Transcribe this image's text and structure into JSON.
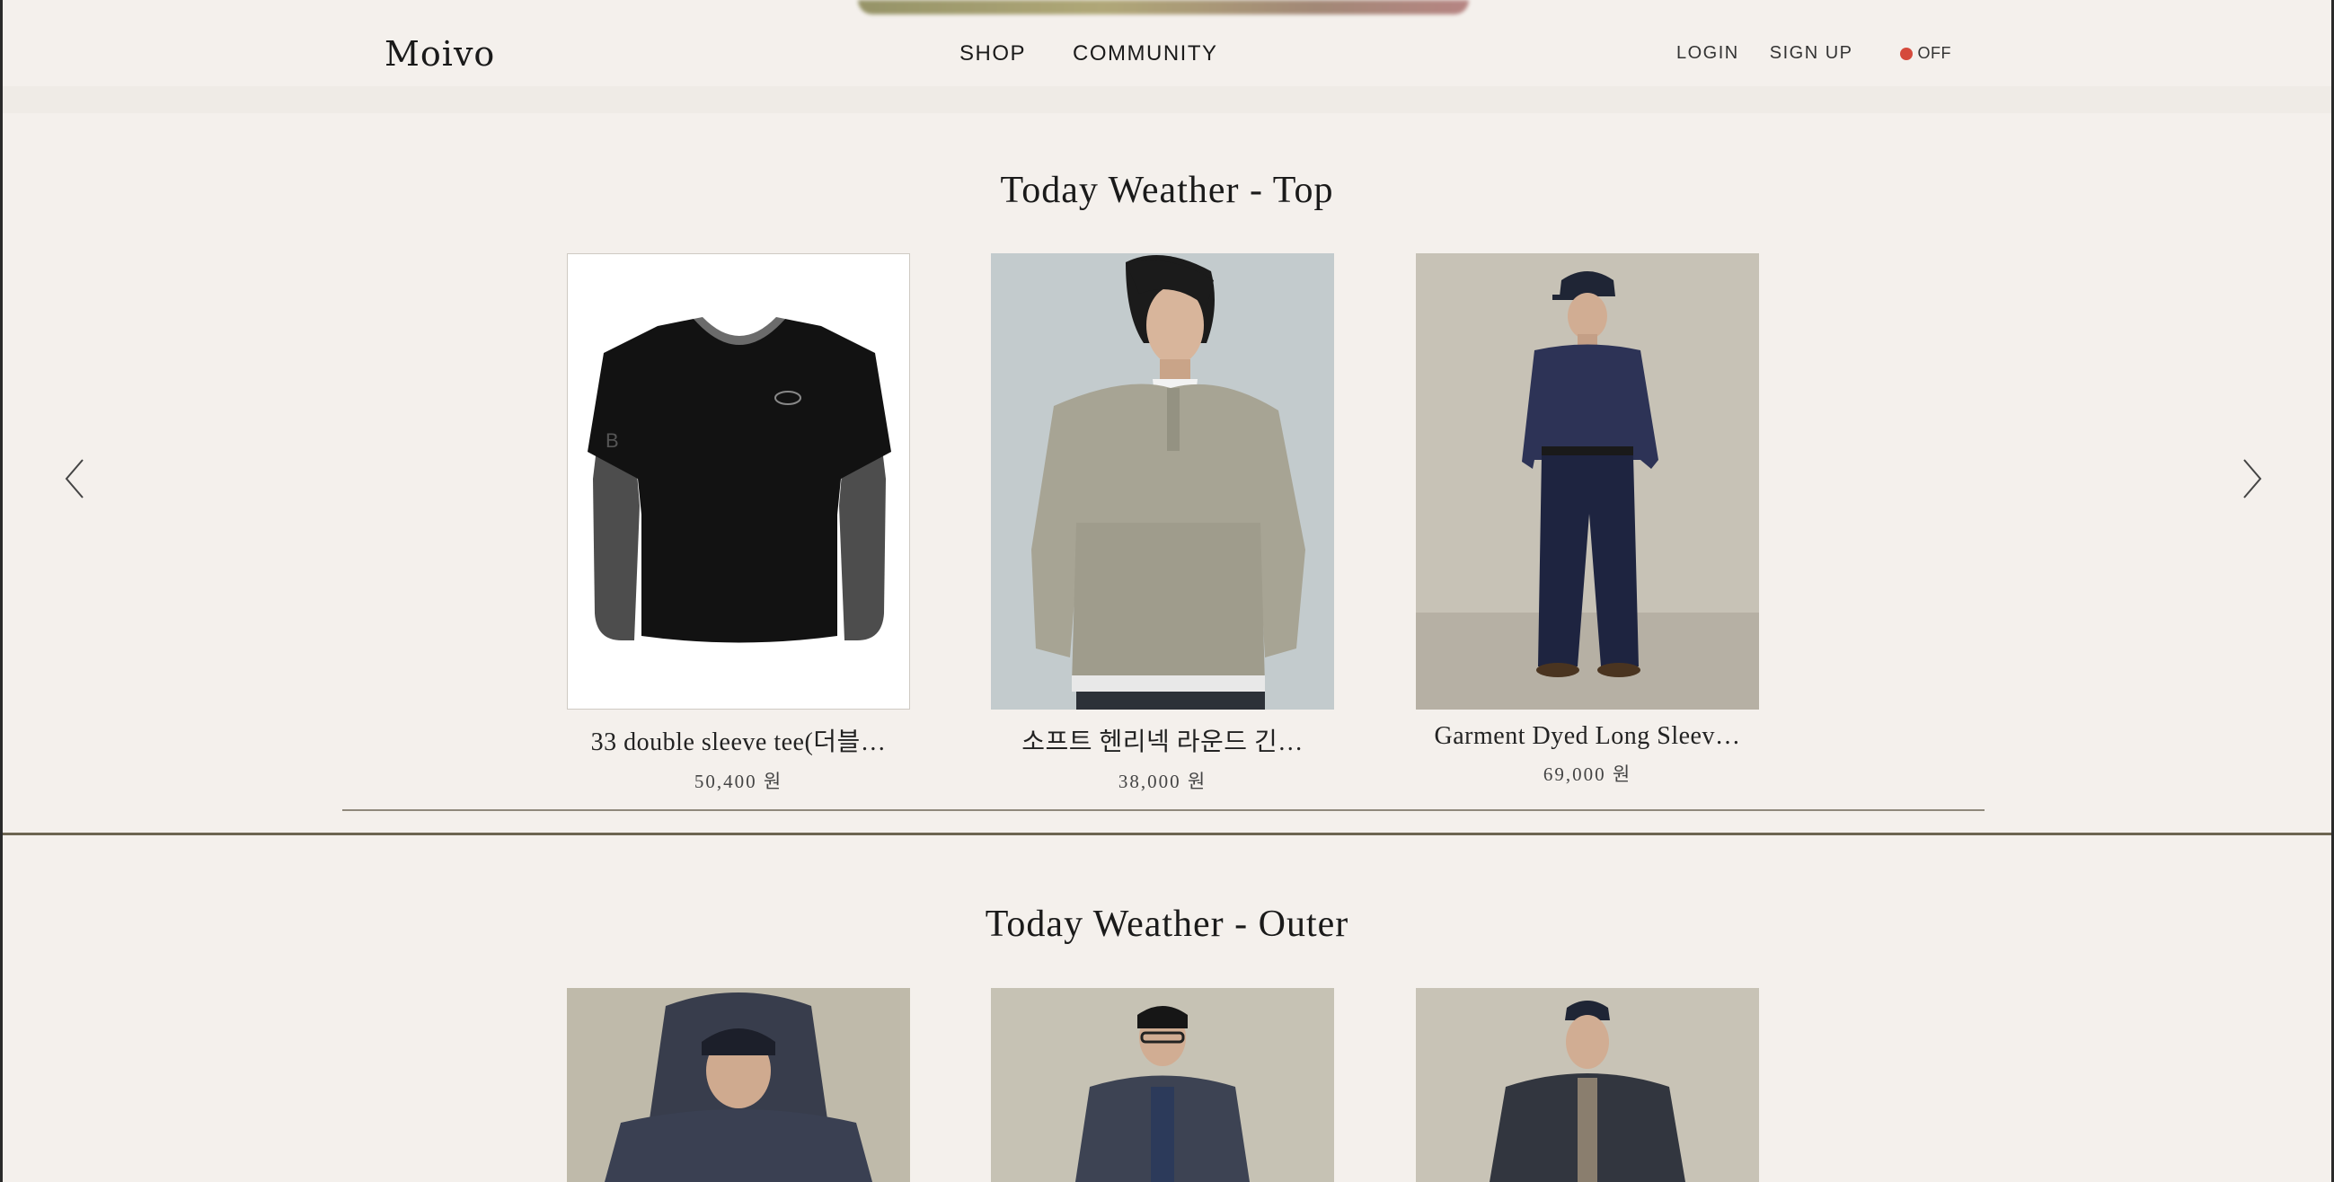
{
  "header": {
    "logo": "Moivo",
    "nav": [
      "SHOP",
      "COMMUNITY"
    ],
    "login": "LOGIN",
    "signup": "SIGN UP",
    "toggle_label": "OFF",
    "toggle_color": "#d54a3c"
  },
  "sections": [
    {
      "title": "Today Weather - Top",
      "products": [
        {
          "name": "33 double sleeve tee(더블…",
          "price": "50,400 원"
        },
        {
          "name": "소프트 헨리넥 라운드 긴…",
          "price": "38,000 원"
        },
        {
          "name": "Garment Dyed Long Sleev…",
          "price": "69,000 원"
        }
      ]
    },
    {
      "title": "Today Weather - Outer",
      "products": [
        {
          "name": "",
          "price": ""
        },
        {
          "name": "",
          "price": ""
        },
        {
          "name": "",
          "price": ""
        }
      ]
    }
  ],
  "icons": {
    "prev": "chevron-left-icon",
    "next": "chevron-right-icon"
  },
  "colors": {
    "background": "#f4f0ec",
    "divider": "#8f897c",
    "accent_red": "#d54a3c"
  }
}
